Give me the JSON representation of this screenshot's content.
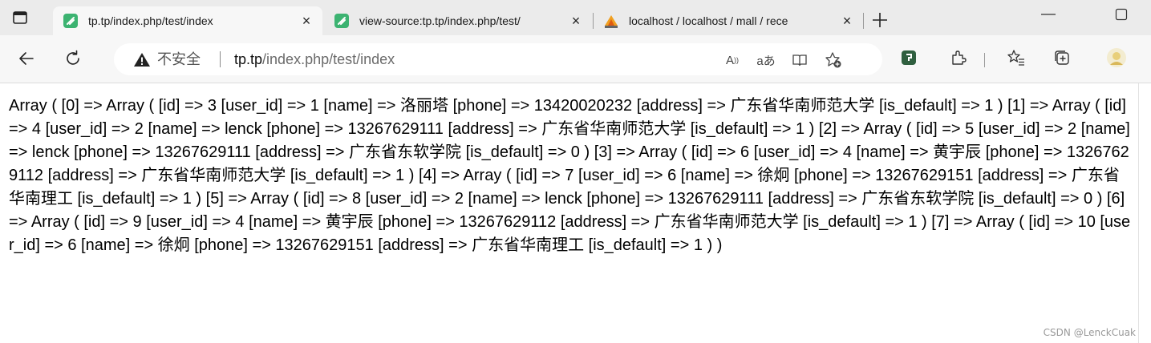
{
  "tabs": [
    {
      "title": "tp.tp/index.php/test/index",
      "close": "×",
      "active": true
    },
    {
      "title": "view-source:tp.tp/index.php/test/",
      "close": "×",
      "active": false
    },
    {
      "title": "localhost / localhost / mall / rece",
      "close": "×",
      "active": false
    }
  ],
  "newtab_icon": "plus-icon",
  "addressbar": {
    "security_label": "不安全",
    "url_host": "tp.tp",
    "url_path": "/index.php/test/index"
  },
  "toolbar_icons": [
    "back-icon",
    "refresh-icon",
    "read-aloud-icon",
    "translate-icon",
    "immersive-reader-icon",
    "add-favorite-icon",
    "extension-icon",
    "extensions-icon",
    "favorites-icon",
    "collections-icon",
    "profile-icon"
  ],
  "address_buttons": {
    "read_aloud": "A",
    "translate": "aあ"
  },
  "content": {
    "output_text": "Array ( [0] => Array ( [id] => 3 [user_id] => 1 [name] => 洛丽塔 [phone] => 13420020232 [address] => 广东省华南师范大学 [is_default] => 1 ) [1] => Array ( [id] => 4 [user_id] => 2 [name] => lenck [phone] => 13267629111 [address] => 广东省华南师范大学 [is_default] => 1 ) [2] => Array ( [id] => 5 [user_id] => 2 [name] => lenck [phone] => 13267629111 [address] => 广东省东软学院 [is_default] => 0 ) [3] => Array ( [id] => 6 [user_id] => 4 [name] => 黄宇辰 [phone] => 13267629112 [address] => 广东省华南师范大学 [is_default] => 1 ) [4] => Array ( [id] => 7 [user_id] => 6 [name] => 徐炯 [phone] => 13267629151 [address] => 广东省华南理工 [is_default] => 1 ) [5] => Array ( [id] => 8 [user_id] => 2 [name] => lenck [phone] => 13267629111 [address] => 广东省东软学院 [is_default] => 0 ) [6] => Array ( [id] => 9 [user_id] => 4 [name] => 黄宇辰 [phone] => 13267629112 [address] => 广东省华南师范大学 [is_default] => 1 ) [7] => Array ( [id] => 10 [user_id] => 6 [name] => 徐炯 [phone] => 13267629151 [address] => 广东省华南理工 [is_default] => 1 ) )"
  },
  "watermark": "CSDN @LenckCuak",
  "colors": {
    "tabstrip": "#ebebeb",
    "toolbar": "#f7f7f7",
    "favicon_green": "#3cb371",
    "pma_orange": "#f0a020"
  }
}
